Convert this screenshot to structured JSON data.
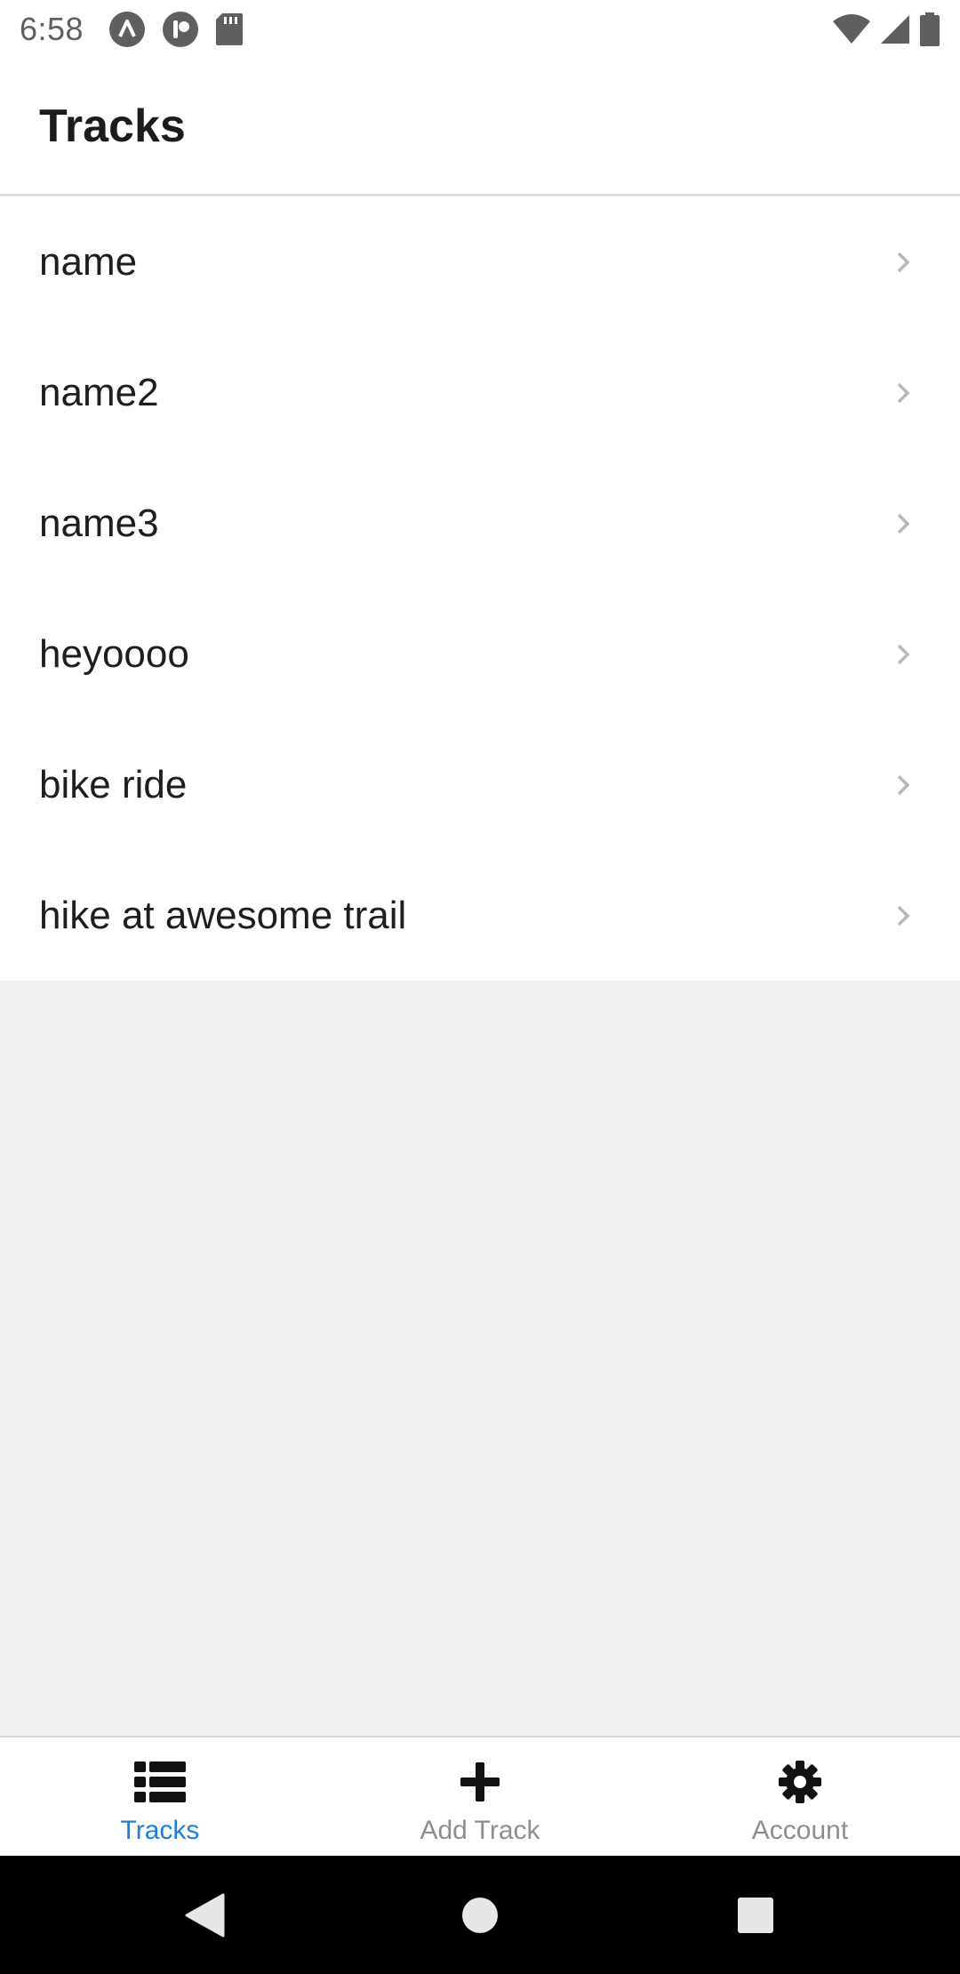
{
  "status_bar": {
    "time": "6:58",
    "left_icons": [
      "autofill-a-icon",
      "pocket-casts-icon",
      "sd-card-icon"
    ],
    "right_icons": [
      "wifi-icon",
      "signal-icon",
      "battery-icon"
    ]
  },
  "header": {
    "title": "Tracks"
  },
  "tracks": [
    {
      "label": "name"
    },
    {
      "label": "name2"
    },
    {
      "label": "name3"
    },
    {
      "label": "heyoooo"
    },
    {
      "label": "bike ride"
    },
    {
      "label": "hike at awesome trail"
    }
  ],
  "tab_bar": {
    "tabs": [
      {
        "label": "Tracks",
        "icon": "list-icon",
        "active": true
      },
      {
        "label": "Add Track",
        "icon": "plus-icon",
        "active": false
      },
      {
        "label": "Account",
        "icon": "gear-icon",
        "active": false
      }
    ]
  },
  "nav_bar": {
    "buttons": [
      "back-icon",
      "home-icon",
      "recents-icon"
    ]
  },
  "colors": {
    "accent": "#1a7fe0",
    "inactive_tab": "#8e8e8e",
    "background": "#f0f0f0"
  }
}
